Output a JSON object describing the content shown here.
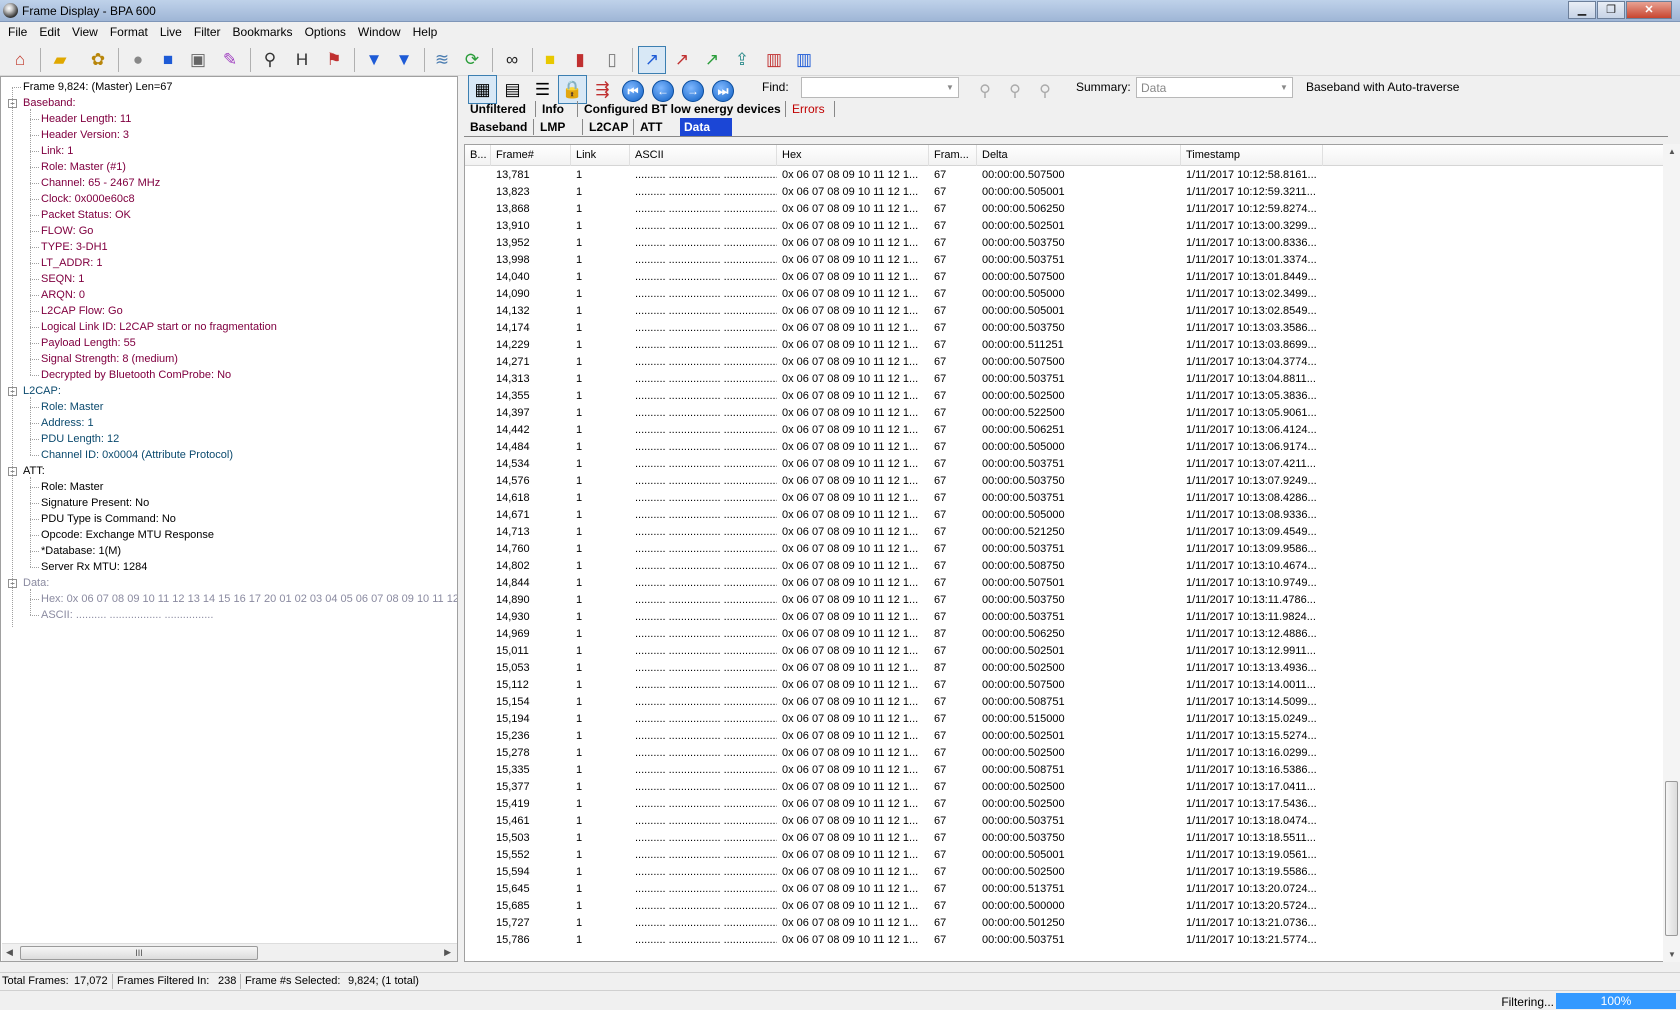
{
  "window": {
    "title": "Frame Display - BPA 600",
    "minimize": "▁",
    "restore": "❐",
    "close": "✕"
  },
  "menu": [
    "File",
    "Edit",
    "View",
    "Format",
    "Live",
    "Filter",
    "Bookmarks",
    "Options",
    "Window",
    "Help"
  ],
  "toolbar_icons": [
    "home-icon",
    "open-folder-icon",
    "reload-capture-icon",
    "record-icon",
    "stop-icon",
    "save-icon",
    "clear-icon",
    "search-icon",
    "header-icon",
    "event-icon",
    "filter-icon",
    "filter-add-icon",
    "layers-icon",
    "refresh-icon",
    "find-binoculars-icon",
    "note-icon",
    "book-icon",
    "open-book-icon",
    "chart-line-icon",
    "chart-red-icon",
    "chart-green-icon",
    "export-icon",
    "bar-chart-icon",
    "bar-chart2-icon"
  ],
  "tree": {
    "root": "Frame 9,824: (Master) Len=67",
    "sections": [
      {
        "label": "Baseband:",
        "color": "#800040",
        "items": [
          "Header Length: 11",
          "Header Version: 3",
          "Link: 1",
          "Role: Master (#1)",
          "Channel: 65 - 2467 MHz",
          "Clock: 0x000e60c8",
          "Packet Status: OK",
          "FLOW: Go",
          "TYPE: 3-DH1",
          "LT_ADDR: 1",
          "SEQN: 1",
          "ARQN: 0",
          "L2CAP Flow: Go",
          "Logical Link ID: L2CAP start or no fragmentation",
          "Payload Length: 55",
          "Signal Strength: 8 (medium)",
          "Decrypted by Bluetooth ComProbe: No"
        ]
      },
      {
        "label": "L2CAP:",
        "color": "#0b4a6e",
        "items": [
          "Role: Master",
          "Address: 1",
          "PDU Length: 12",
          "Channel ID: 0x0004  (Attribute Protocol)"
        ]
      },
      {
        "label": "ATT:",
        "color": "#000000",
        "items": [
          "Role: Master",
          "Signature Present: No",
          "PDU Type is Command: No",
          "Opcode: Exchange MTU Response",
          "*Database: 1(M)",
          "Server Rx MTU: 1284"
        ]
      },
      {
        "label": "Data:",
        "color": "#8a8aa0",
        "items": [
          "Hex: 0x 06 07 08 09 10 11 12 13 14 15 16 17 20 01 02 03 04 05 06 07 08 09 10 11 12",
          "ASCII: .......... ................. ................"
        ]
      }
    ]
  },
  "find": {
    "label": "Find:",
    "value": ""
  },
  "summary": {
    "label": "Summary:",
    "value": "Data"
  },
  "mode_label": "Baseband with Auto-traverse",
  "filter_tabs_row1": [
    "Unfiltered",
    "Info",
    "Configured BT low energy devices",
    "Errors"
  ],
  "filter_tabs_row2": [
    "Baseband",
    "LMP",
    "L2CAP",
    "ATT",
    "Data"
  ],
  "columns": [
    "B...",
    "Frame#",
    "Link",
    "ASCII",
    "Hex",
    "Fram...",
    "Delta",
    "Timestamp"
  ],
  "rows": [
    [
      "13,781",
      "1",
      "67",
      "00:00:00.507500",
      "1/11/2017 10:12:58.8161..."
    ],
    [
      "13,823",
      "1",
      "67",
      "00:00:00.505001",
      "1/11/2017 10:12:59.3211..."
    ],
    [
      "13,868",
      "1",
      "67",
      "00:00:00.506250",
      "1/11/2017 10:12:59.8274..."
    ],
    [
      "13,910",
      "1",
      "67",
      "00:00:00.502501",
      "1/11/2017 10:13:00.3299..."
    ],
    [
      "13,952",
      "1",
      "67",
      "00:00:00.503750",
      "1/11/2017 10:13:00.8336..."
    ],
    [
      "13,998",
      "1",
      "67",
      "00:00:00.503751",
      "1/11/2017 10:13:01.3374..."
    ],
    [
      "14,040",
      "1",
      "67",
      "00:00:00.507500",
      "1/11/2017 10:13:01.8449..."
    ],
    [
      "14,090",
      "1",
      "67",
      "00:00:00.505000",
      "1/11/2017 10:13:02.3499..."
    ],
    [
      "14,132",
      "1",
      "67",
      "00:00:00.505001",
      "1/11/2017 10:13:02.8549..."
    ],
    [
      "14,174",
      "1",
      "67",
      "00:00:00.503750",
      "1/11/2017 10:13:03.3586..."
    ],
    [
      "14,229",
      "1",
      "67",
      "00:00:00.511251",
      "1/11/2017 10:13:03.8699..."
    ],
    [
      "14,271",
      "1",
      "67",
      "00:00:00.507500",
      "1/11/2017 10:13:04.3774..."
    ],
    [
      "14,313",
      "1",
      "67",
      "00:00:00.503751",
      "1/11/2017 10:13:04.8811..."
    ],
    [
      "14,355",
      "1",
      "67",
      "00:00:00.502500",
      "1/11/2017 10:13:05.3836..."
    ],
    [
      "14,397",
      "1",
      "67",
      "00:00:00.522500",
      "1/11/2017 10:13:05.9061..."
    ],
    [
      "14,442",
      "1",
      "67",
      "00:00:00.506251",
      "1/11/2017 10:13:06.4124..."
    ],
    [
      "14,484",
      "1",
      "67",
      "00:00:00.505000",
      "1/11/2017 10:13:06.9174..."
    ],
    [
      "14,534",
      "1",
      "67",
      "00:00:00.503751",
      "1/11/2017 10:13:07.4211..."
    ],
    [
      "14,576",
      "1",
      "67",
      "00:00:00.503750",
      "1/11/2017 10:13:07.9249..."
    ],
    [
      "14,618",
      "1",
      "67",
      "00:00:00.503751",
      "1/11/2017 10:13:08.4286..."
    ],
    [
      "14,671",
      "1",
      "67",
      "00:00:00.505000",
      "1/11/2017 10:13:08.9336..."
    ],
    [
      "14,713",
      "1",
      "67",
      "00:00:00.521250",
      "1/11/2017 10:13:09.4549..."
    ],
    [
      "14,760",
      "1",
      "67",
      "00:00:00.503751",
      "1/11/2017 10:13:09.9586..."
    ],
    [
      "14,802",
      "1",
      "67",
      "00:00:00.508750",
      "1/11/2017 10:13:10.4674..."
    ],
    [
      "14,844",
      "1",
      "67",
      "00:00:00.507501",
      "1/11/2017 10:13:10.9749..."
    ],
    [
      "14,890",
      "1",
      "67",
      "00:00:00.503750",
      "1/11/2017 10:13:11.4786..."
    ],
    [
      "14,930",
      "1",
      "67",
      "00:00:00.503751",
      "1/11/2017 10:13:11.9824..."
    ],
    [
      "14,969",
      "1",
      "87",
      "00:00:00.506250",
      "1/11/2017 10:13:12.4886..."
    ],
    [
      "15,011",
      "1",
      "67",
      "00:00:00.502501",
      "1/11/2017 10:13:12.9911..."
    ],
    [
      "15,053",
      "1",
      "87",
      "00:00:00.502500",
      "1/11/2017 10:13:13.4936..."
    ],
    [
      "15,112",
      "1",
      "67",
      "00:00:00.507500",
      "1/11/2017 10:13:14.0011..."
    ],
    [
      "15,154",
      "1",
      "67",
      "00:00:00.508751",
      "1/11/2017 10:13:14.5099..."
    ],
    [
      "15,194",
      "1",
      "67",
      "00:00:00.515000",
      "1/11/2017 10:13:15.0249..."
    ],
    [
      "15,236",
      "1",
      "67",
      "00:00:00.502501",
      "1/11/2017 10:13:15.5274..."
    ],
    [
      "15,278",
      "1",
      "67",
      "00:00:00.502500",
      "1/11/2017 10:13:16.0299..."
    ],
    [
      "15,335",
      "1",
      "67",
      "00:00:00.508751",
      "1/11/2017 10:13:16.5386..."
    ],
    [
      "15,377",
      "1",
      "67",
      "00:00:00.502500",
      "1/11/2017 10:13:17.0411..."
    ],
    [
      "15,419",
      "1",
      "67",
      "00:00:00.502500",
      "1/11/2017 10:13:17.5436..."
    ],
    [
      "15,461",
      "1",
      "67",
      "00:00:00.503751",
      "1/11/2017 10:13:18.0474..."
    ],
    [
      "15,503",
      "1",
      "67",
      "00:00:00.503750",
      "1/11/2017 10:13:18.5511..."
    ],
    [
      "15,552",
      "1",
      "67",
      "00:00:00.505001",
      "1/11/2017 10:13:19.0561..."
    ],
    [
      "15,594",
      "1",
      "67",
      "00:00:00.502500",
      "1/11/2017 10:13:19.5586..."
    ],
    [
      "15,645",
      "1",
      "67",
      "00:00:00.513751",
      "1/11/2017 10:13:20.0724..."
    ],
    [
      "15,685",
      "1",
      "67",
      "00:00:00.500000",
      "1/11/2017 10:13:20.5724..."
    ],
    [
      "15,727",
      "1",
      "67",
      "00:00:00.501250",
      "1/11/2017 10:13:21.0736..."
    ],
    [
      "15,786",
      "1",
      "67",
      "00:00:00.503751",
      "1/11/2017 10:13:21.5774..."
    ]
  ],
  "row_ascii": ".......... ................. ..................",
  "row_hex": "0x 06 07 08 09 10 11 12 1...",
  "status": {
    "total_frames_label": "Total Frames:",
    "total_frames": "17,072",
    "filtered_label": "Frames Filtered In:",
    "filtered": "238",
    "selected_label": "Frame #s Selected:",
    "selected": "9,824; (1 total)",
    "filtering": "Filtering...",
    "progress": "100%"
  },
  "scrollbar_grip": "III"
}
